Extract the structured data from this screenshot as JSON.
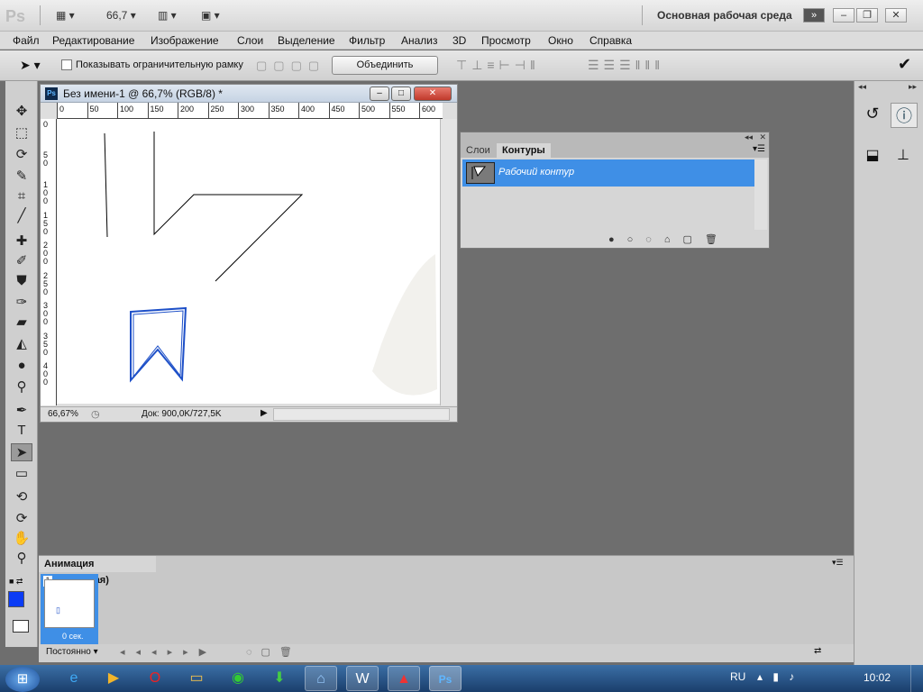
{
  "app": {
    "logo": "Ps",
    "zoom_field": "66,7",
    "workspace_label": "Основная рабочая среда"
  },
  "menu": [
    "Файл",
    "Редактирование",
    "Изображение",
    "Слои",
    "Выделение",
    "Фильтр",
    "Анализ",
    "3D",
    "Просмотр",
    "Окно",
    "Справка"
  ],
  "options": {
    "show_bounding_box_label": "Показывать ограничительную рамку",
    "combine_button": "Объединить"
  },
  "document": {
    "title": "Без имени-1 @ 66,7% (RGB/8) *",
    "zoom": "66,67%",
    "doc_size": "Док: 900,0K/727,5K",
    "hruler_labels": [
      "0",
      "50",
      "100",
      "150",
      "200",
      "250",
      "300",
      "350",
      "400",
      "450",
      "500",
      "550",
      "600"
    ],
    "vruler_labels": [
      "0",
      "5\n0",
      "1\n0\n0",
      "1\n5\n0",
      "2\n0\n0",
      "2\n5\n0",
      "3\n0\n0",
      "3\n5\n0",
      "4\n0\n0"
    ]
  },
  "paths_panel": {
    "tabs": [
      "Слои",
      "Контуры"
    ],
    "active_tab": "Контуры",
    "items": [
      {
        "name": "Рабочий контур"
      }
    ]
  },
  "animation": {
    "title": "Анимация (покадровая)",
    "frame_number": "1",
    "frame_delay": "0 сек.",
    "loop": "Постоянно"
  },
  "taskbar": {
    "lang": "RU",
    "time": "10:02"
  },
  "colors": {
    "accent_blue": "#1e50c8",
    "selection_blue": "#3f8fe6",
    "foreground": "#0b3cf5"
  }
}
